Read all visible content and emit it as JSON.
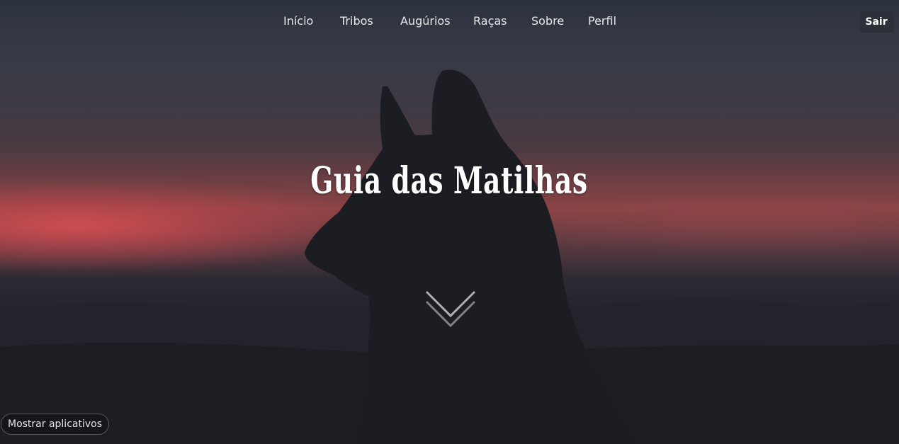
{
  "nav": {
    "items": [
      {
        "label": "Início"
      },
      {
        "label": "Tribos"
      },
      {
        "label": "Augúrios"
      },
      {
        "label": "Raças"
      },
      {
        "label": "Sobre"
      },
      {
        "label": "Perfil"
      }
    ],
    "logout_label": "Sair"
  },
  "hero": {
    "title": "Guia das Matilhas",
    "scroll_icon": "chevron-double-down-icon"
  },
  "apps_toggle": {
    "label": "Mostrar aplicativos"
  },
  "colors": {
    "sky_dark": "#2c323d",
    "sunset_red": "#e05054",
    "silhouette": "#1c1d22",
    "text": "#ffffff"
  }
}
